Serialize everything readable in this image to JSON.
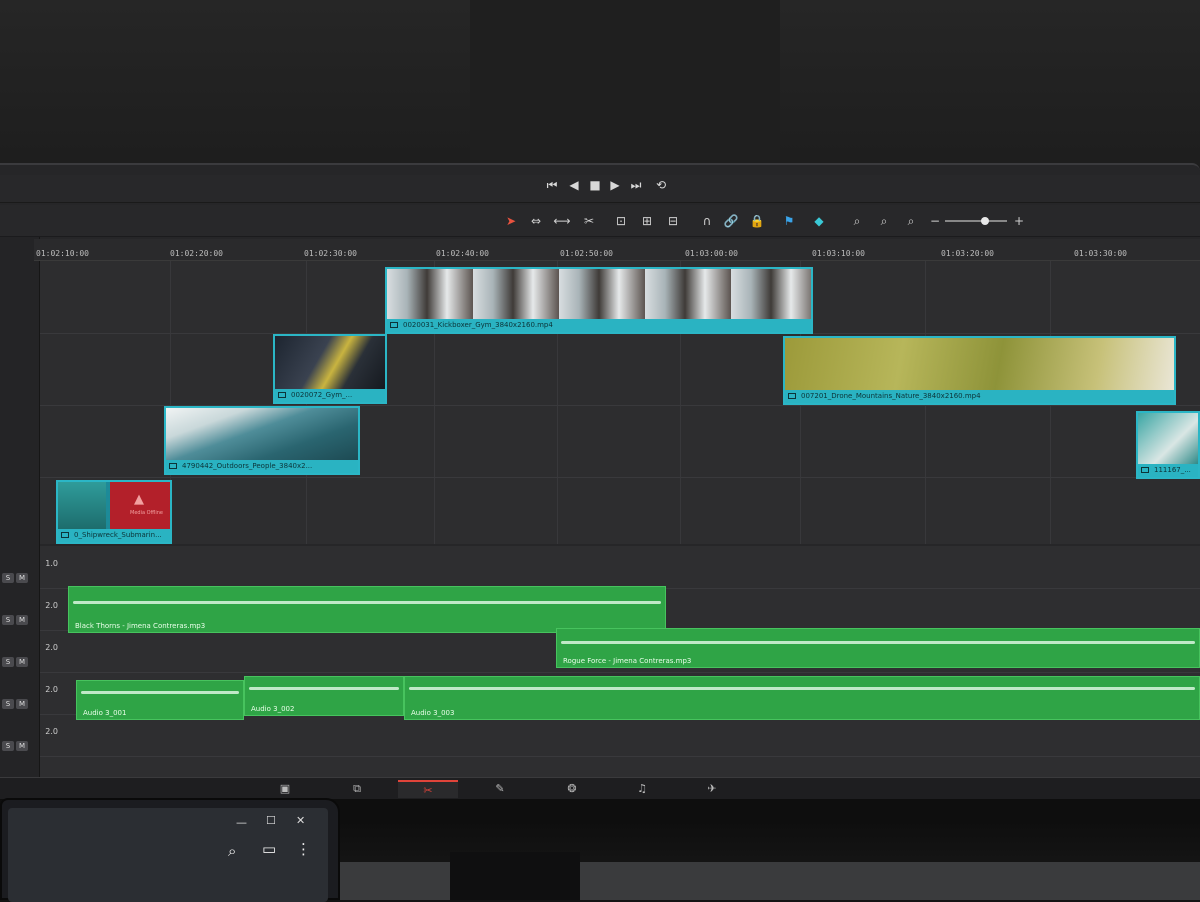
{
  "transport": {
    "prev": "⏮",
    "back": "◀",
    "stop": "■",
    "play": "▶",
    "next": "⏭",
    "loop": "⟲"
  },
  "toolbar": {
    "select": "➤",
    "trim": "⇔",
    "blade_edit": "⟷",
    "blade": "✂",
    "insert": "⊡",
    "overwrite": "⊞",
    "replace": "⊟",
    "snap": "∩",
    "link": "🔗",
    "lock": "🔒",
    "flag": "⚑",
    "marker": "◆",
    "zoom_full": "⌕",
    "zoom_detail": "⌕",
    "zoom_custom": "⌕",
    "zoom_out": "−",
    "zoom_in": "+"
  },
  "ruler": {
    "timecodes": [
      "01:02:10:00",
      "01:02:20:00",
      "01:02:30:00",
      "01:02:40:00",
      "01:02:50:00",
      "01:03:00:00",
      "01:03:10:00",
      "01:03:20:00",
      "01:03:30:00"
    ]
  },
  "video_clips": [
    {
      "name": "0020031_Kickboxer_Gym_3840x2160.mp4"
    },
    {
      "name": "0020072_Gym_..."
    },
    {
      "name": "4790442_Outdoors_People_3840x2..."
    },
    {
      "name": "0_Shipwreck_Submarin..."
    },
    {
      "name": "007201_Drone_Mountains_Nature_3840x2160.mp4"
    },
    {
      "name": "111167_..."
    }
  ],
  "offline_label": "Media Offline",
  "audio_tracks": [
    {
      "level": "1.0",
      "solo": "S",
      "mute": "M"
    },
    {
      "level": "2.0",
      "solo": "S",
      "mute": "M"
    },
    {
      "level": "2.0",
      "solo": "S",
      "mute": "M"
    },
    {
      "level": "2.0",
      "solo": "S",
      "mute": "M"
    },
    {
      "level": "2.0",
      "solo": "S",
      "mute": "M"
    }
  ],
  "audio_clips": [
    {
      "name": "Black Thorns - Jimena Contreras.mp3"
    },
    {
      "name": "Rogue Force - Jimena Contreras.mp3"
    },
    {
      "name": "Audio 3_001"
    },
    {
      "name": "Audio 3_002"
    },
    {
      "name": "Audio 3_003"
    }
  ],
  "pages": [
    "▣",
    "⧉",
    "✂",
    "✎",
    "❂",
    "♫",
    "✈"
  ],
  "tablet": {
    "minimize": "—",
    "maximize": "☐",
    "close": "✕",
    "search": "⌕",
    "tabs": "▭",
    "menu": "⋮"
  },
  "colors": {
    "video_clip": "#2ab3c2",
    "audio_clip": "#2fa446",
    "active_page": "#e0443a"
  }
}
